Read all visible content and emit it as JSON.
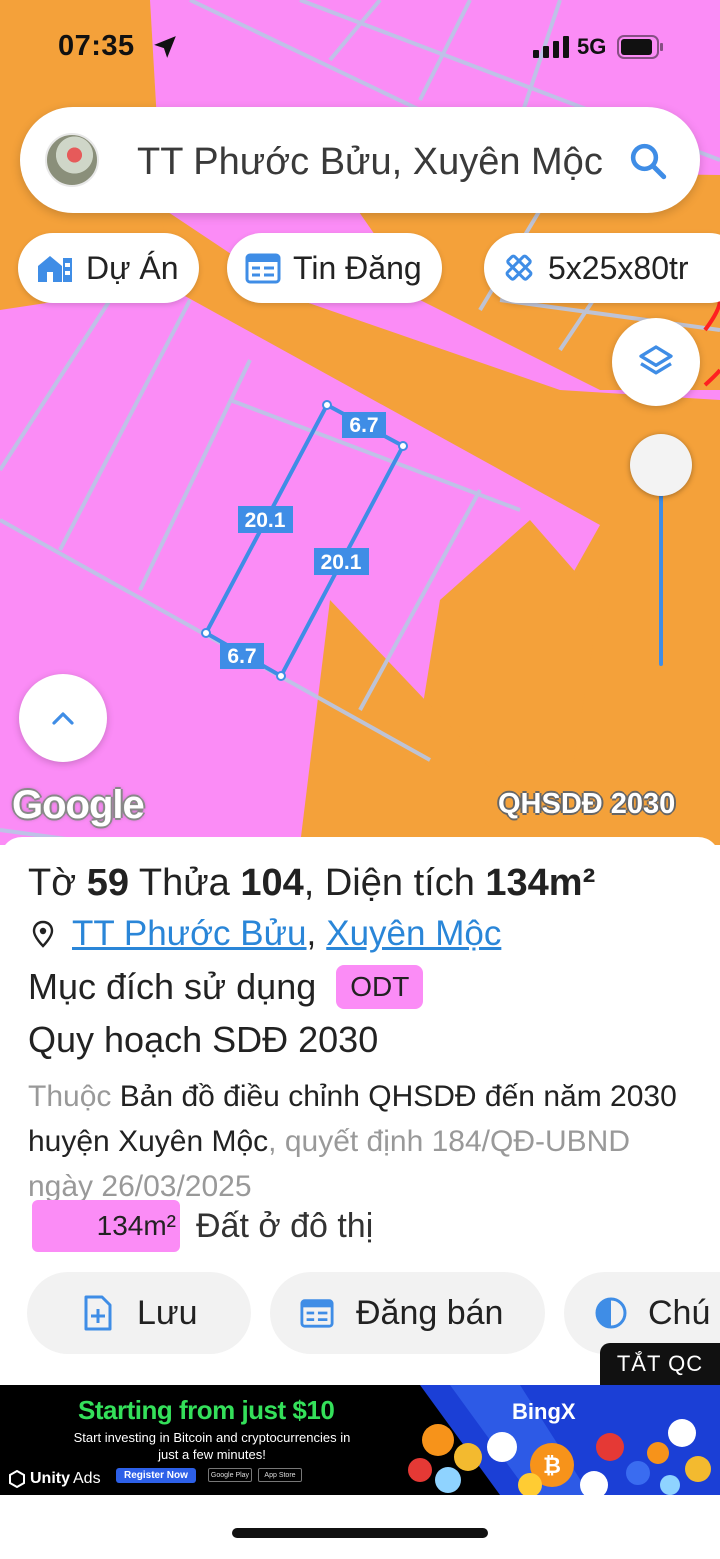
{
  "status_bar": {
    "time": "07:35",
    "network": "5G"
  },
  "search": {
    "query": "TT Phước Bửu, Xuyên Mộc",
    "icon": "search-icon"
  },
  "chips": [
    {
      "label": "Dự Án",
      "icon": "building-icon"
    },
    {
      "label": "Tin Đăng",
      "icon": "listing-icon"
    },
    {
      "label": "5x25x80tr",
      "icon": "ruler-icon"
    }
  ],
  "map": {
    "google_logo": "Google",
    "layer_badge": "QHSDĐ 2030",
    "dimension_labels": [
      "6.7",
      "20.1",
      "20.1",
      "6.7"
    ],
    "colors": {
      "land_residential": "#fb8cf6",
      "land_other": "#f4a13a",
      "parcel_outline": "#3f8de6"
    }
  },
  "parcel": {
    "title_prefix": "Tờ",
    "sheet_number": "59",
    "title_mid": "Thửa",
    "plot_number": "104",
    "title_area_label": ", Diện tích",
    "area": "134m²",
    "address_ward": "TT Phước Bửu",
    "address_district": "Xuyên Mộc",
    "purpose_label": "Mục đích sử dụng",
    "purpose_code": "ODT",
    "plan_title": "Quy hoạch SDĐ 2030",
    "desc_prefix": "Thuộc",
    "desc_main": "Bản đồ điều chỉnh QHSDĐ đến năm 2030 huyện Xuyên Mộc",
    "desc_suffix": ", quyết định 184/QĐ-UBND ngày 26/03/2025",
    "land_area": "134m²",
    "land_type": "Đất ở đô thị"
  },
  "actions": [
    {
      "label": "Lưu",
      "icon": "add-file-icon"
    },
    {
      "label": "Đăng bán",
      "icon": "listing-icon"
    },
    {
      "label": "Chú",
      "icon": "contrast-icon"
    }
  ],
  "ad": {
    "hide_label": "TẮT QC",
    "headline": "Starting from just $10",
    "subtext": "Start investing in Bitcoin and cryptocurrencies in just a few minutes!",
    "cta": "Register Now",
    "store_google": "Google Play",
    "store_apple": "App Store",
    "network": "Unity",
    "network_suffix": "Ads",
    "brand": "BingX"
  }
}
